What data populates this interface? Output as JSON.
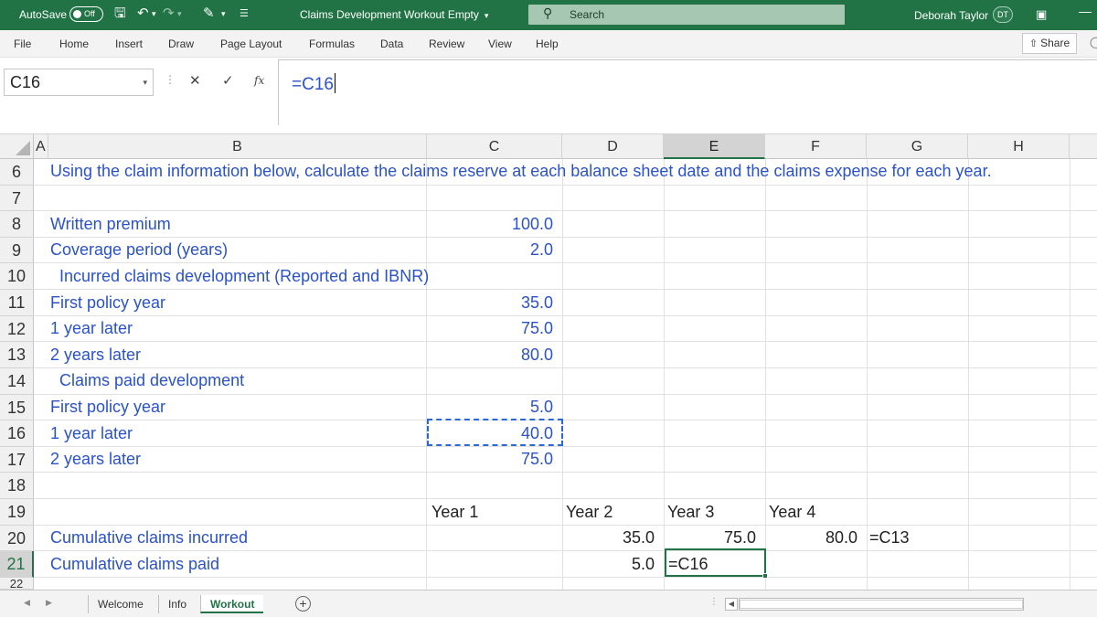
{
  "titlebar": {
    "autosave_label": "AutoSave",
    "autosave_state": "Off",
    "doc_title": "Claims Development Workout Empty",
    "search_placeholder": "Search",
    "user_name": "Deborah Taylor",
    "user_initials": "DT"
  },
  "menu": {
    "tabs": [
      "File",
      "Home",
      "Insert",
      "Draw",
      "Page Layout",
      "Formulas",
      "Data",
      "Review",
      "View",
      "Help"
    ],
    "share_label": "Share"
  },
  "formula_bar": {
    "name_box": "C16",
    "formula": "=C16"
  },
  "columns": [
    "A",
    "B",
    "C",
    "D",
    "E",
    "F",
    "G",
    "H"
  ],
  "rows": [
    "6",
    "7",
    "8",
    "9",
    "10",
    "11",
    "12",
    "13",
    "14",
    "15",
    "16",
    "17",
    "18",
    "19",
    "20",
    "21",
    "22"
  ],
  "sheet": {
    "instruction": "Using the claim information below, calculate the claims reserve at each balance sheet date and the claims expense for each year.",
    "written_premium": {
      "label": "Written premium",
      "value": "100.0"
    },
    "coverage_period": {
      "label": "Coverage period (years)",
      "value": "2.0"
    },
    "incurred_header": "Incurred claims development (Reported and IBNR)",
    "incurred": [
      {
        "label": "First policy year",
        "value": "35.0"
      },
      {
        "label": "1 year later",
        "value": "75.0"
      },
      {
        "label": "2 years later",
        "value": "80.0"
      }
    ],
    "paid_header": "Claims paid development",
    "paid": [
      {
        "label": "First policy year",
        "value": "5.0"
      },
      {
        "label": "1 year later",
        "value": "40.0"
      },
      {
        "label": "2 years later",
        "value": "75.0"
      }
    ],
    "year_headers": [
      "Year 1",
      "Year 2",
      "Year 3",
      "Year 4"
    ],
    "cum_incurred": {
      "label": "Cumulative claims incurred",
      "d": "35.0",
      "e": "75.0",
      "f": "80.0",
      "g": "=C13"
    },
    "cum_paid": {
      "label": "Cumulative claims paid",
      "d": "5.0",
      "e": "=C16"
    }
  },
  "sheet_tabs": [
    "Welcome",
    "Info",
    "Workout"
  ],
  "active_sheet": "Workout",
  "colors": {
    "accent": "#217346",
    "input_blue": "#2a52c9"
  }
}
